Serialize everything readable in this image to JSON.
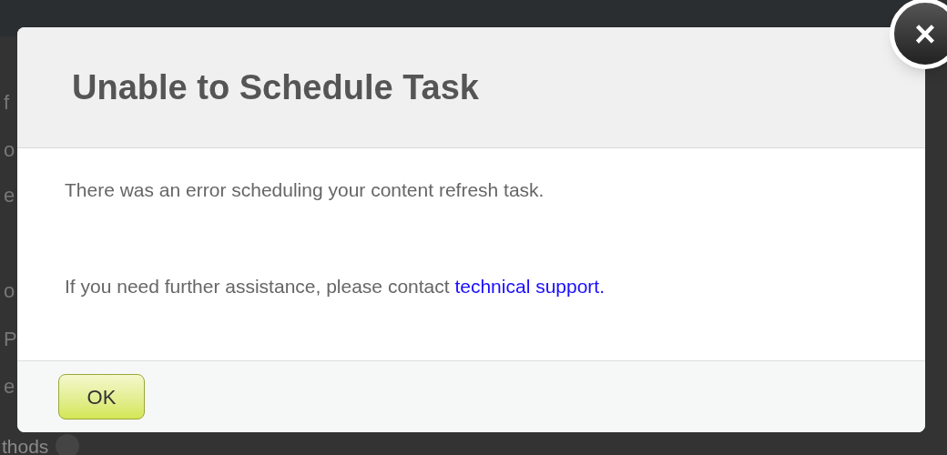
{
  "background": {
    "fragments": [
      "f",
      "o",
      "e",
      "o",
      "P",
      "e",
      "thods"
    ]
  },
  "dialog": {
    "title": "Unable to Schedule Task",
    "message": "There was an error scheduling your content refresh task.",
    "help_text": "If you need further assistance, please contact ",
    "help_link": "technical support.",
    "ok_button": "OK",
    "close_button": "×"
  }
}
